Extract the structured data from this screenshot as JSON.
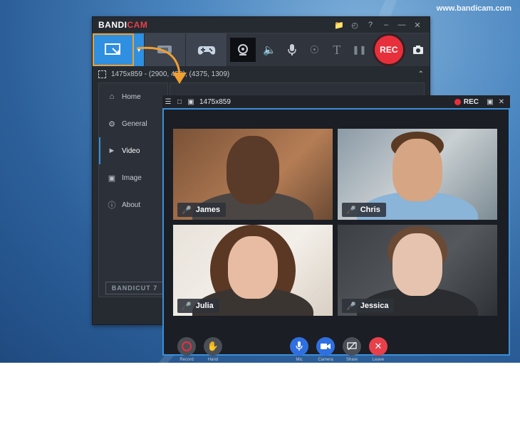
{
  "watermark": "www.bandicam.com",
  "bandicam": {
    "logo_a": "BANDI",
    "logo_b": "CAM",
    "area_text": "1475x859 - (2900, 450), (4375, 1309)",
    "nav": [
      {
        "label": "Home",
        "icon": "home-icon"
      },
      {
        "label": "General",
        "icon": "gear-icon"
      },
      {
        "label": "Video",
        "icon": "video-icon"
      },
      {
        "label": "Image",
        "icon": "image-icon"
      },
      {
        "label": "About",
        "icon": "info-icon"
      }
    ],
    "rec_label": "REC",
    "bandicut_a": "BANDI",
    "bandicut_b": "CUT 7"
  },
  "capture": {
    "size_label": "1475x859",
    "rec_label": "REC",
    "participants": [
      "James",
      "Chris",
      "Julia",
      "Jessica"
    ],
    "controls": [
      "Record",
      "Hand",
      "Mic",
      "Camera",
      "Share",
      "Leave"
    ]
  },
  "colors": {
    "accent": "#2f8fe0",
    "rec": "#e8303c",
    "highlight": "#f0a030",
    "mic_active": "#3fc073"
  }
}
